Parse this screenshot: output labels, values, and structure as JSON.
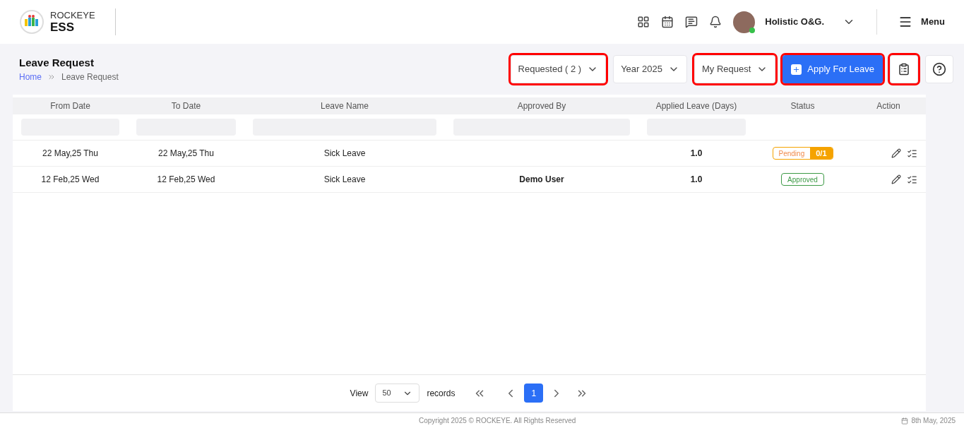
{
  "header": {
    "brand_top": "ROCKEYE",
    "brand_bottom": "ESS",
    "user_name": "Holistic O&G.",
    "user_online": true,
    "menu_label": "Menu"
  },
  "page": {
    "title": "Leave Request",
    "breadcrumb": [
      {
        "label": "Home",
        "kind": "link"
      },
      {
        "label": "Leave Request",
        "kind": "current"
      }
    ]
  },
  "toolbar": [
    {
      "kind": "dropdown",
      "label": "Requested ( 2 )",
      "highlighted": true
    },
    {
      "kind": "dropdown",
      "label": "Year 2025",
      "highlighted": false
    },
    {
      "kind": "dropdown",
      "label": "My Request",
      "highlighted": true
    },
    {
      "kind": "primary",
      "label": "Apply For Leave",
      "highlighted": true
    },
    {
      "kind": "clipboard",
      "highlighted": true
    },
    {
      "kind": "help",
      "highlighted": false
    }
  ],
  "table": {
    "columns": [
      {
        "label": "From Date",
        "filter": true
      },
      {
        "label": "To Date",
        "filter": true
      },
      {
        "label": "Leave Name",
        "filter": true
      },
      {
        "label": "Approved By",
        "filter": true
      },
      {
        "label": "Applied Leave (Days)",
        "filter": true
      },
      {
        "label": "Status",
        "filter": false
      },
      {
        "label": "Action",
        "filter": false
      }
    ],
    "rows": [
      {
        "from": "22 May,25 Thu",
        "to": "22 May,25 Thu",
        "leave": "Sick Leave",
        "approved_by": "",
        "days": "1.0",
        "status": {
          "kind": "pending",
          "label": "Pending",
          "count": "0/1"
        }
      },
      {
        "from": "12 Feb,25 Wed",
        "to": "12 Feb,25 Wed",
        "leave": "Sick Leave",
        "approved_by": "Demo User",
        "days": "1.0",
        "status": {
          "kind": "approved",
          "label": "Approved"
        }
      }
    ]
  },
  "pagination": {
    "view_label": "View",
    "page_size": "50",
    "records_label": "records",
    "pages": [
      {
        "label": "1",
        "selected": true
      }
    ]
  },
  "footer": {
    "copyright": "Copyright 2025 © ROCKEYE. All Rights Reserved",
    "date": "8th May, 2025"
  }
}
